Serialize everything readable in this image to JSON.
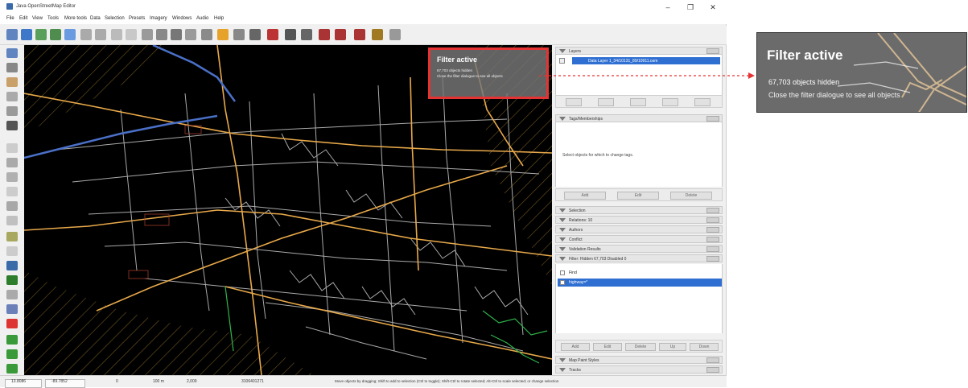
{
  "app": {
    "title": "Java OpenStreetMap Editor",
    "window_controls": {
      "minimize": "–",
      "maximize": "❐",
      "close": "✕"
    }
  },
  "menu": [
    "File",
    "Edit",
    "View",
    "Tools",
    "More tools",
    "Data",
    "Selection",
    "Presets",
    "Imagery",
    "Windows",
    "Audio",
    "Help"
  ],
  "map": {
    "filter_overlay": {
      "title": "Filter active",
      "line1": "67,703 objects hidden",
      "line2": "Close the filter dialogue to see all objects"
    }
  },
  "status_bar": {
    "coord_lat": "13.8086",
    "coord_lon": "-89.7852",
    "heading": "0",
    "distance": "100 m",
    "zoom": "2,009",
    "object_id": "3106401271",
    "hint": "Move objects by dragging; Shift to add to selection (Ctrl to toggle); Shift-Ctrl to rotate selected; Alt-Ctrl to scale selected; or change selection"
  },
  "panels": {
    "layers": {
      "title": "Layers",
      "layer_name": "Data Layer 1_34/10131_89/10911.osm"
    },
    "tags": {
      "title": "Tags/Memberships",
      "message": "Select objects for which to change tags.",
      "buttons": {
        "add": "Add",
        "edit": "Edit",
        "delete": "Delete"
      }
    },
    "sections": [
      {
        "name": "Selection"
      },
      {
        "name": "Relations: 10"
      },
      {
        "name": "Authors"
      },
      {
        "name": "Conflict"
      },
      {
        "name": "Validation Results"
      },
      {
        "name": "Filter: Hidden 67,703 Disabled 0"
      }
    ],
    "filters": {
      "items": [
        {
          "label": "Find",
          "selected": false
        },
        {
          "label": "highway=*",
          "selected": true
        }
      ],
      "buttons": {
        "add": "Add",
        "edit": "Edit",
        "delete": "Delete",
        "up": "Up",
        "down": "Down"
      }
    },
    "bottom_sections": [
      {
        "name": "Map Paint Styles"
      },
      {
        "name": "Tracks"
      }
    ]
  },
  "colors": {
    "accent": "#2f6fd2",
    "filter_border": "#e53333",
    "road_major": "#e8a94a",
    "road_minor": "#c8c8c8"
  }
}
